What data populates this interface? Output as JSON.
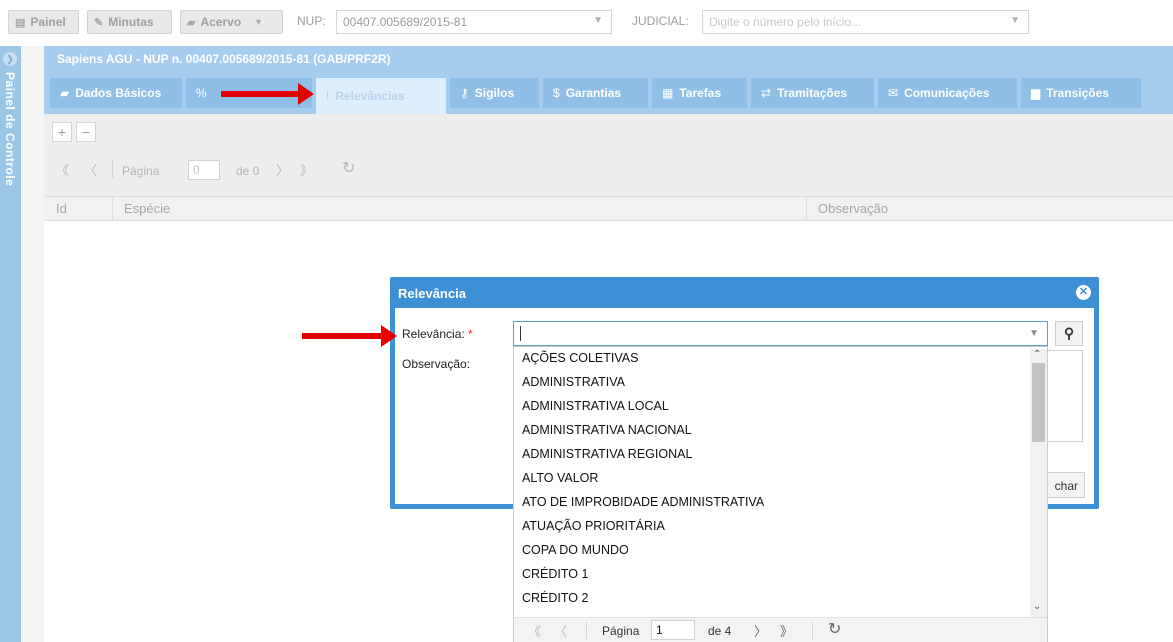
{
  "toolbar": {
    "painel_label": "Painel",
    "minutas_label": "Minutas",
    "acervo_label": "Acervo",
    "nup_label": "NUP:",
    "nup_value": "00407.005689/2015-81",
    "judicial_label": "JUDICIAL:",
    "judicial_placeholder": "Digite o número pelo início..."
  },
  "left_panel": {
    "label": "Painel de Controle"
  },
  "window": {
    "title": "Sapiens AGU - NUP n. 00407.005689/2015-81 (GAB/PRF2R)",
    "tabs": [
      {
        "label": "Dados Básicos",
        "icon": "folder-icon"
      },
      {
        "label": "",
        "icon": "link-icon"
      },
      {
        "label": "Relevâncias",
        "icon": "exclamation-icon"
      },
      {
        "label": "Sigilos",
        "icon": "key-icon"
      },
      {
        "label": "Garantias",
        "icon": "dollar-icon"
      },
      {
        "label": "Tarefas",
        "icon": "calendar-icon"
      },
      {
        "label": "Tramitações",
        "icon": "exchange-icon"
      },
      {
        "label": "Comunicações",
        "icon": "envelope-icon"
      },
      {
        "label": "Transições",
        "icon": "archive-icon"
      }
    ]
  },
  "grid": {
    "pager": {
      "page_label": "Página",
      "page_value": "0",
      "of_label": "de 0"
    },
    "columns": [
      "Id",
      "Espécie",
      "Observação"
    ]
  },
  "dialog": {
    "title": "Relevância",
    "relevancia_label": "Relevância:",
    "required_mark": "*",
    "observacao_label": "Observação:",
    "fechar_label": "char"
  },
  "dropdown": {
    "items": [
      "AÇÕES COLETIVAS",
      "ADMINISTRATIVA",
      "ADMINISTRATIVA LOCAL",
      "ADMINISTRATIVA NACIONAL",
      "ADMINISTRATIVA REGIONAL",
      "ALTO VALOR",
      "ATO DE IMPROBIDADE ADMINISTRATIVA",
      "ATUAÇÃO PRIORITÁRIA",
      "COPA DO MUNDO",
      "CRÉDITO 1",
      "CRÉDITO 2"
    ],
    "pager": {
      "page_label": "Página",
      "page_value": "1",
      "of_label": "de 4"
    }
  },
  "colors": {
    "accent": "#3d8fd6",
    "tabbar": "#a6cdee",
    "arrow": "#e40000"
  }
}
